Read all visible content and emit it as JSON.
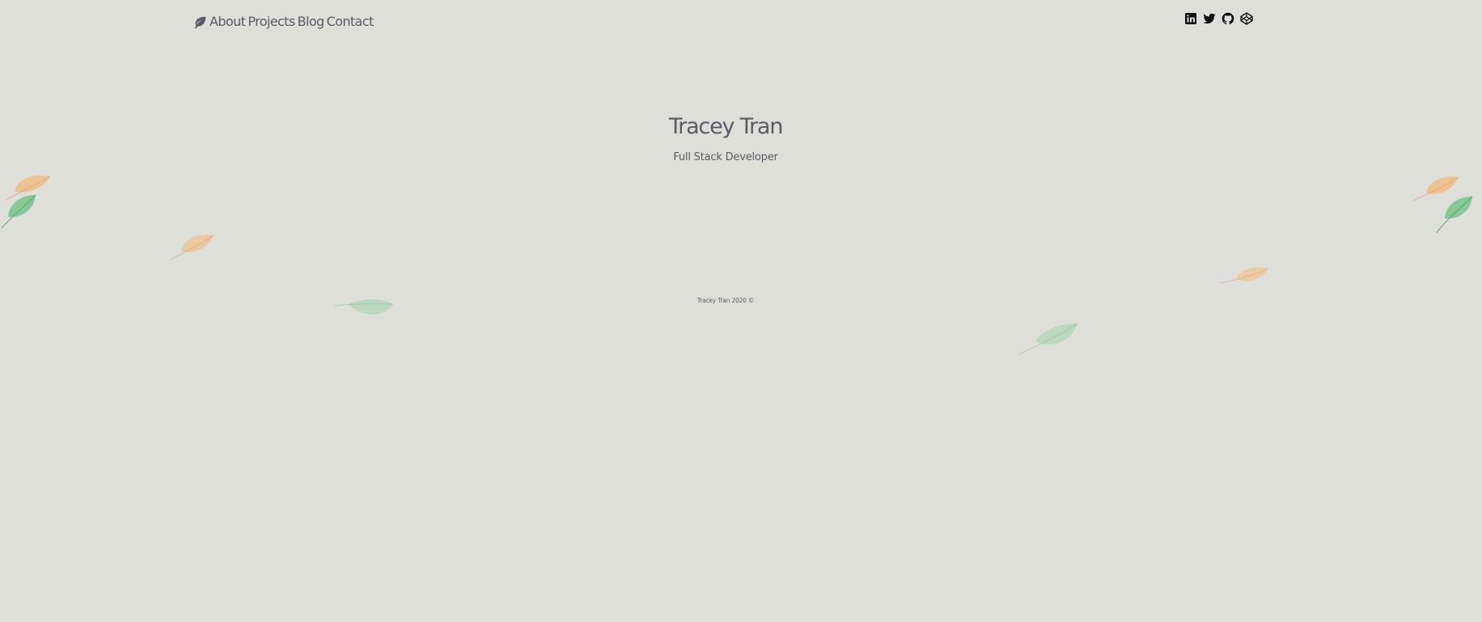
{
  "nav": {
    "logo_icon": "leaf-icon",
    "links": [
      "About",
      "Projects",
      "Blog",
      "Contact"
    ]
  },
  "social": {
    "icons": [
      "linkedin-icon",
      "twitter-icon",
      "github-icon",
      "codepen-icon"
    ]
  },
  "hero": {
    "name": "Tracey Tran",
    "role": "Full Stack Developer"
  },
  "footer": {
    "text": "Tracey Tran 2020 ©"
  },
  "colors": {
    "background": "#dfdfda",
    "text": "#5b5b68",
    "leaf_orange": "#f0bb7a",
    "leaf_green": "#6fc385"
  }
}
